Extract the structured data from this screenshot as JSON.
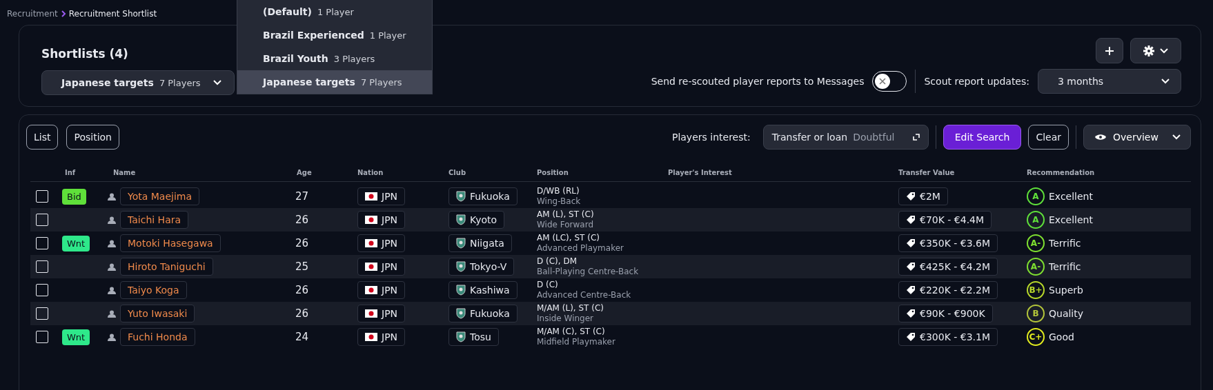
{
  "breadcrumb": [
    {
      "label": "Recruitment"
    },
    {
      "label": "Recruitment Shortlist"
    }
  ],
  "shortlists": {
    "title": "Shortlists (4)",
    "current": {
      "name": "Japanese targets",
      "count": "7 Players"
    },
    "menu": [
      {
        "name": "(Default)",
        "count": "1 Player",
        "selected": false
      },
      {
        "name": "Brazil Experienced",
        "count": "1 Player",
        "selected": false
      },
      {
        "name": "Brazil Youth",
        "count": "3 Players",
        "selected": false
      },
      {
        "name": "Japanese targets",
        "count": "7 Players",
        "selected": true
      }
    ],
    "toggle": {
      "label": "Send re-scouted player reports to Messages",
      "on": false
    },
    "scout_updates": {
      "label": "Scout report updates:",
      "value": "3 months"
    }
  },
  "toolbar": {
    "views": [
      {
        "label": "List"
      },
      {
        "label": "Position"
      }
    ],
    "interest_label": "Players interest:",
    "interest_value": "Transfer or loan",
    "interest_level": "Doubtful",
    "edit": "Edit Search",
    "clear": "Clear",
    "overview": "Overview"
  },
  "table": {
    "columns": [
      "Inf",
      "Name",
      "Age",
      "Nation",
      "Club",
      "Position",
      "Player's Interest",
      "Transfer Value",
      "Recommendation"
    ],
    "rows": [
      {
        "checked": false,
        "badge": {
          "label": "Bid",
          "color": "#5fe03a"
        },
        "name": "Yota Maejima",
        "age": "27",
        "nation": "JPN",
        "club": "Fukuoka",
        "position": "D/WB (RL)",
        "role": "Wing-Back",
        "value": "€2M",
        "grade": "A",
        "color": "#5fe03a",
        "rating": "Excellent"
      },
      {
        "checked": false,
        "name": "Taichi Hara",
        "age": "26",
        "nation": "JPN",
        "club": "Kyoto",
        "position": "AM (L), ST (C)",
        "role": "Wide Forward",
        "value": "€70K - €4.4M",
        "grade": "A",
        "color": "#5fe03a",
        "rating": "Excellent"
      },
      {
        "checked": false,
        "badge": {
          "label": "Wnt",
          "color": "#2ee88a"
        },
        "name": "Motoki Hasegawa",
        "age": "26",
        "nation": "JPN",
        "club": "Niigata",
        "position": "AM (LC), ST (C)",
        "role": "Advanced Playmaker",
        "value": "€350K - €3.6M",
        "grade": "A-",
        "color": "#7fe030",
        "rating": "Terrific"
      },
      {
        "checked": false,
        "name": "Hiroto Taniguchi",
        "age": "25",
        "nation": "JPN",
        "club": "Tokyo-V",
        "position": "D (C), DM",
        "role": "Ball-Playing Centre-Back",
        "value": "€425K - €4.2M",
        "grade": "A-",
        "color": "#7fe030",
        "rating": "Terrific"
      },
      {
        "checked": false,
        "name": "Taiyo Koga",
        "age": "26",
        "nation": "JPN",
        "club": "Kashiwa",
        "position": "D (C)",
        "role": "Advanced Centre-Back",
        "value": "€220K - €2.2M",
        "grade": "B+",
        "color": "#b8d82a",
        "rating": "Superb"
      },
      {
        "checked": false,
        "name": "Yuto Iwasaki",
        "age": "26",
        "nation": "JPN",
        "club": "Fukuoka",
        "position": "M/AM (L), ST (C)",
        "role": "Inside Winger",
        "value": "€90K - €900K",
        "grade": "B",
        "color": "#b4c63a",
        "rating": "Quality"
      },
      {
        "checked": false,
        "badge": {
          "label": "Wnt",
          "color": "#2ee88a"
        },
        "name": "Fuchi Honda",
        "age": "24",
        "nation": "JPN",
        "club": "Tosu",
        "position": "M/AM (C), ST (C)",
        "role": "Midfield Playmaker",
        "value": "€300K - €3.1M",
        "grade": "C+",
        "color": "#e2ec1e",
        "rating": "Good"
      }
    ]
  }
}
